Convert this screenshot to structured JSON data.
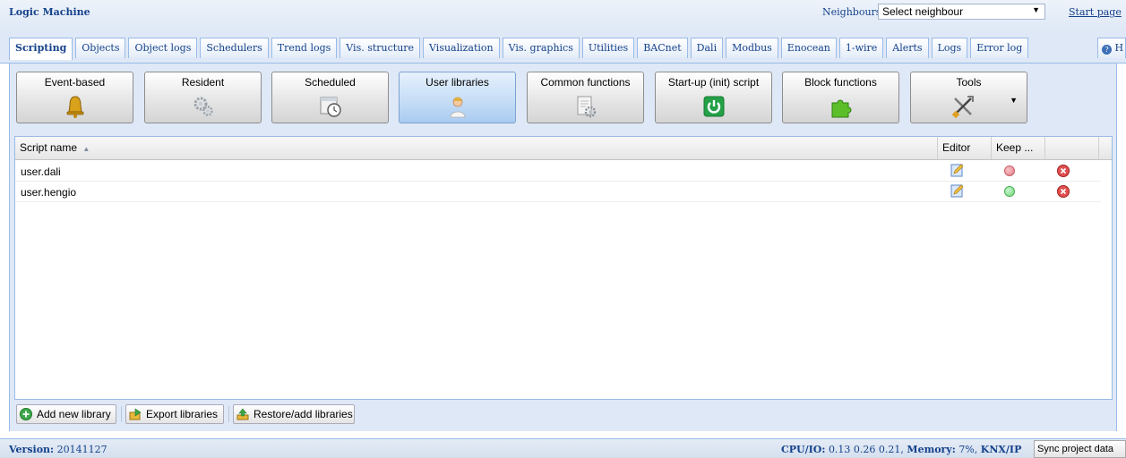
{
  "app": {
    "title": "Logic Machine"
  },
  "header": {
    "neighbours_label": "Neighbours:",
    "neighbour_select": "Select neighbour",
    "start_page": "Start page"
  },
  "tabs": [
    {
      "label": "Scripting",
      "active": true
    },
    {
      "label": "Objects"
    },
    {
      "label": "Object logs"
    },
    {
      "label": "Schedulers"
    },
    {
      "label": "Trend logs"
    },
    {
      "label": "Vis. structure"
    },
    {
      "label": "Visualization"
    },
    {
      "label": "Vis. graphics"
    },
    {
      "label": "Utilities"
    },
    {
      "label": "BACnet"
    },
    {
      "label": "Dali"
    },
    {
      "label": "Modbus"
    },
    {
      "label": "Enocean"
    },
    {
      "label": "1-wire"
    },
    {
      "label": "Alerts"
    },
    {
      "label": "Logs"
    },
    {
      "label": "Error log"
    }
  ],
  "help_tab": "H",
  "tools": [
    {
      "label": "Event-based",
      "icon": "bell-icon"
    },
    {
      "label": "Resident",
      "icon": "gears-icon"
    },
    {
      "label": "Scheduled",
      "icon": "calendar-clock-icon"
    },
    {
      "label": "User libraries",
      "icon": "user-icon",
      "active": true
    },
    {
      "label": "Common functions",
      "icon": "document-gear-icon"
    },
    {
      "label": "Start-up (init) script",
      "icon": "power-icon"
    },
    {
      "label": "Block functions",
      "icon": "puzzle-icon"
    },
    {
      "label": "Tools",
      "icon": "tools-icon"
    }
  ],
  "grid": {
    "columns": {
      "name": "Script name",
      "editor": "Editor",
      "keep": "Keep ..."
    },
    "sort_indicator": "▲",
    "rows": [
      {
        "name": "user.dali",
        "keep": "off",
        "keep_color": "#e88e95"
      },
      {
        "name": "user.hengio",
        "keep": "on",
        "keep_color": "#7fe08a"
      }
    ]
  },
  "bottom": {
    "add": "Add new library",
    "export": "Export libraries",
    "restore": "Restore/add libraries"
  },
  "status": {
    "version_label": "Version:",
    "version_value": "20141127",
    "cpu_label": "CPU/IO:",
    "cpu_value": "0.13 0.26 0.21,",
    "mem_label": "Memory:",
    "mem_value": "7%,",
    "knx_label": "KNX/IP",
    "sync": "Sync project data"
  },
  "colors": {
    "header_text": "#15428b",
    "panel_bg": "#dfe8f6",
    "border": "#99bbe8"
  }
}
